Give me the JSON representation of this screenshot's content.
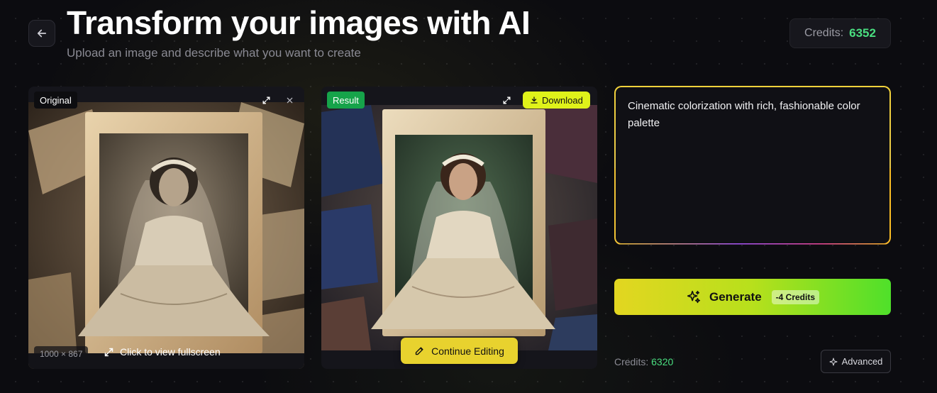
{
  "header": {
    "title": "Transform your images with AI",
    "subtitle": "Upload an image and describe what you want to create"
  },
  "credits_top": {
    "label": "Credits:",
    "value": "6352"
  },
  "original_panel": {
    "badge": "Original",
    "dimensions": "1000 × 867",
    "fullscreen_hint": "Click to view fullscreen",
    "icons": [
      "expand-icon",
      "close-icon"
    ]
  },
  "result_panel": {
    "badge": "Result",
    "download_label": "Download",
    "continue_label": "Continue Editing",
    "icons": [
      "expand-icon",
      "download-icon",
      "pencil-icon"
    ]
  },
  "prompt": {
    "text": "Cinematic colorization with rich, fashionable color palette"
  },
  "generate": {
    "label": "Generate",
    "cost": "-4 Credits",
    "icon": "sparkles-icon"
  },
  "credits_bottom": {
    "label": "Credits:",
    "value": "6320"
  },
  "advanced": {
    "label": "Advanced",
    "icon": "sparkle-icon"
  },
  "colors": {
    "accent_green": "#4ade80",
    "download_yellow": "#dff21a",
    "continue_yellow": "#e8d22e",
    "result_badge": "#16a34a"
  }
}
